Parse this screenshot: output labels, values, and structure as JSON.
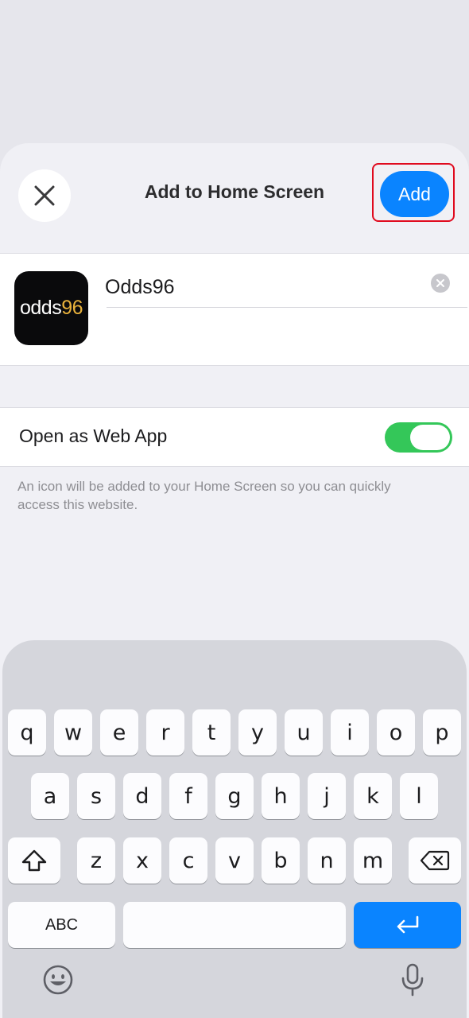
{
  "sheet": {
    "title": "Add to Home Screen",
    "add_label": "Add"
  },
  "app": {
    "icon_text_main": "odds",
    "icon_text_accent": "96",
    "name_value": "Odds96"
  },
  "web_app_toggle": {
    "label": "Open as Web App",
    "state": "on"
  },
  "footnote": "An icon will be added to your Home Screen so you can quickly access this website.",
  "keyboard": {
    "row1": [
      "q",
      "w",
      "e",
      "r",
      "t",
      "y",
      "u",
      "i",
      "o",
      "p"
    ],
    "row2": [
      "a",
      "s",
      "d",
      "f",
      "g",
      "h",
      "j",
      "k",
      "l"
    ],
    "row3": [
      "z",
      "x",
      "c",
      "v",
      "b",
      "n",
      "m"
    ],
    "abc_label": "ABC"
  },
  "colors": {
    "accent": "#0a84ff",
    "toggle_on": "#34c759",
    "highlight": "#e00a1e"
  }
}
